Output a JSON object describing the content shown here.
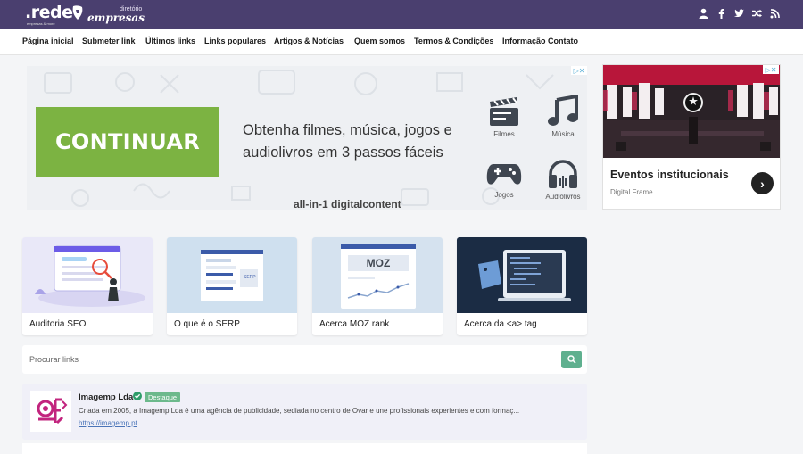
{
  "header": {
    "logo_main": ".rede",
    "logo_tagline": "empresas & more",
    "logo_sub_top": "diretório",
    "logo_sub": "empresas",
    "icons": [
      "user-icon",
      "facebook-icon",
      "twitter-icon",
      "shuffle-icon",
      "rss-icon"
    ]
  },
  "nav": {
    "items": [
      {
        "label": "Página inicial"
      },
      {
        "label": "Submeter link"
      },
      {
        "label": "Últimos links"
      },
      {
        "label": "Links populares"
      },
      {
        "label": "Artigos & Notícias"
      },
      {
        "label": "Quem somos"
      },
      {
        "label": "Termos & Condições"
      },
      {
        "label": "Informação Contato"
      }
    ]
  },
  "ad_main": {
    "button": "CONTINUAR",
    "headline": "Obtenha filmes, música, jogos e audiolivros em 3 passos fáceis",
    "brand": "all-in-1 digitalcontent",
    "categories": [
      {
        "label": "Filmes",
        "icon": "clapperboard-icon"
      },
      {
        "label": "Música",
        "icon": "music-note-icon"
      },
      {
        "label": "Jogos",
        "icon": "gamepad-icon"
      },
      {
        "label": "Audiolivros",
        "icon": "headphones-icon"
      }
    ],
    "accent": "#7cb342"
  },
  "ad_side": {
    "title": "Eventos institucionais",
    "subtitle": "Digital Frame"
  },
  "cards": [
    {
      "label": "Auditoria SEO",
      "thumb_bg": "#e9e8f8"
    },
    {
      "label": "O que é o SERP",
      "thumb_bg": "#cfe0ef"
    },
    {
      "label": "Acerca MOZ rank",
      "thumb_bg": "#d5e2ef",
      "thumb_text": "MOZ"
    },
    {
      "label": "Acerca da <a> tag",
      "thumb_bg": "#1b2c44"
    }
  ],
  "search": {
    "placeholder": "Procurar links"
  },
  "listing": {
    "name": "Imagemp Lda",
    "tag": "Destaque",
    "description": "Criada em 2005, a Imagemp Lda é uma agência de publicidade, sediada no centro de Ovar e une profissionais experientes e com formaç...",
    "url": "https://imagemp.pt"
  },
  "colors": {
    "header_bg": "#4a3f6f",
    "search_button": "#5fb08f",
    "featured_tag": "#6cb98c"
  }
}
